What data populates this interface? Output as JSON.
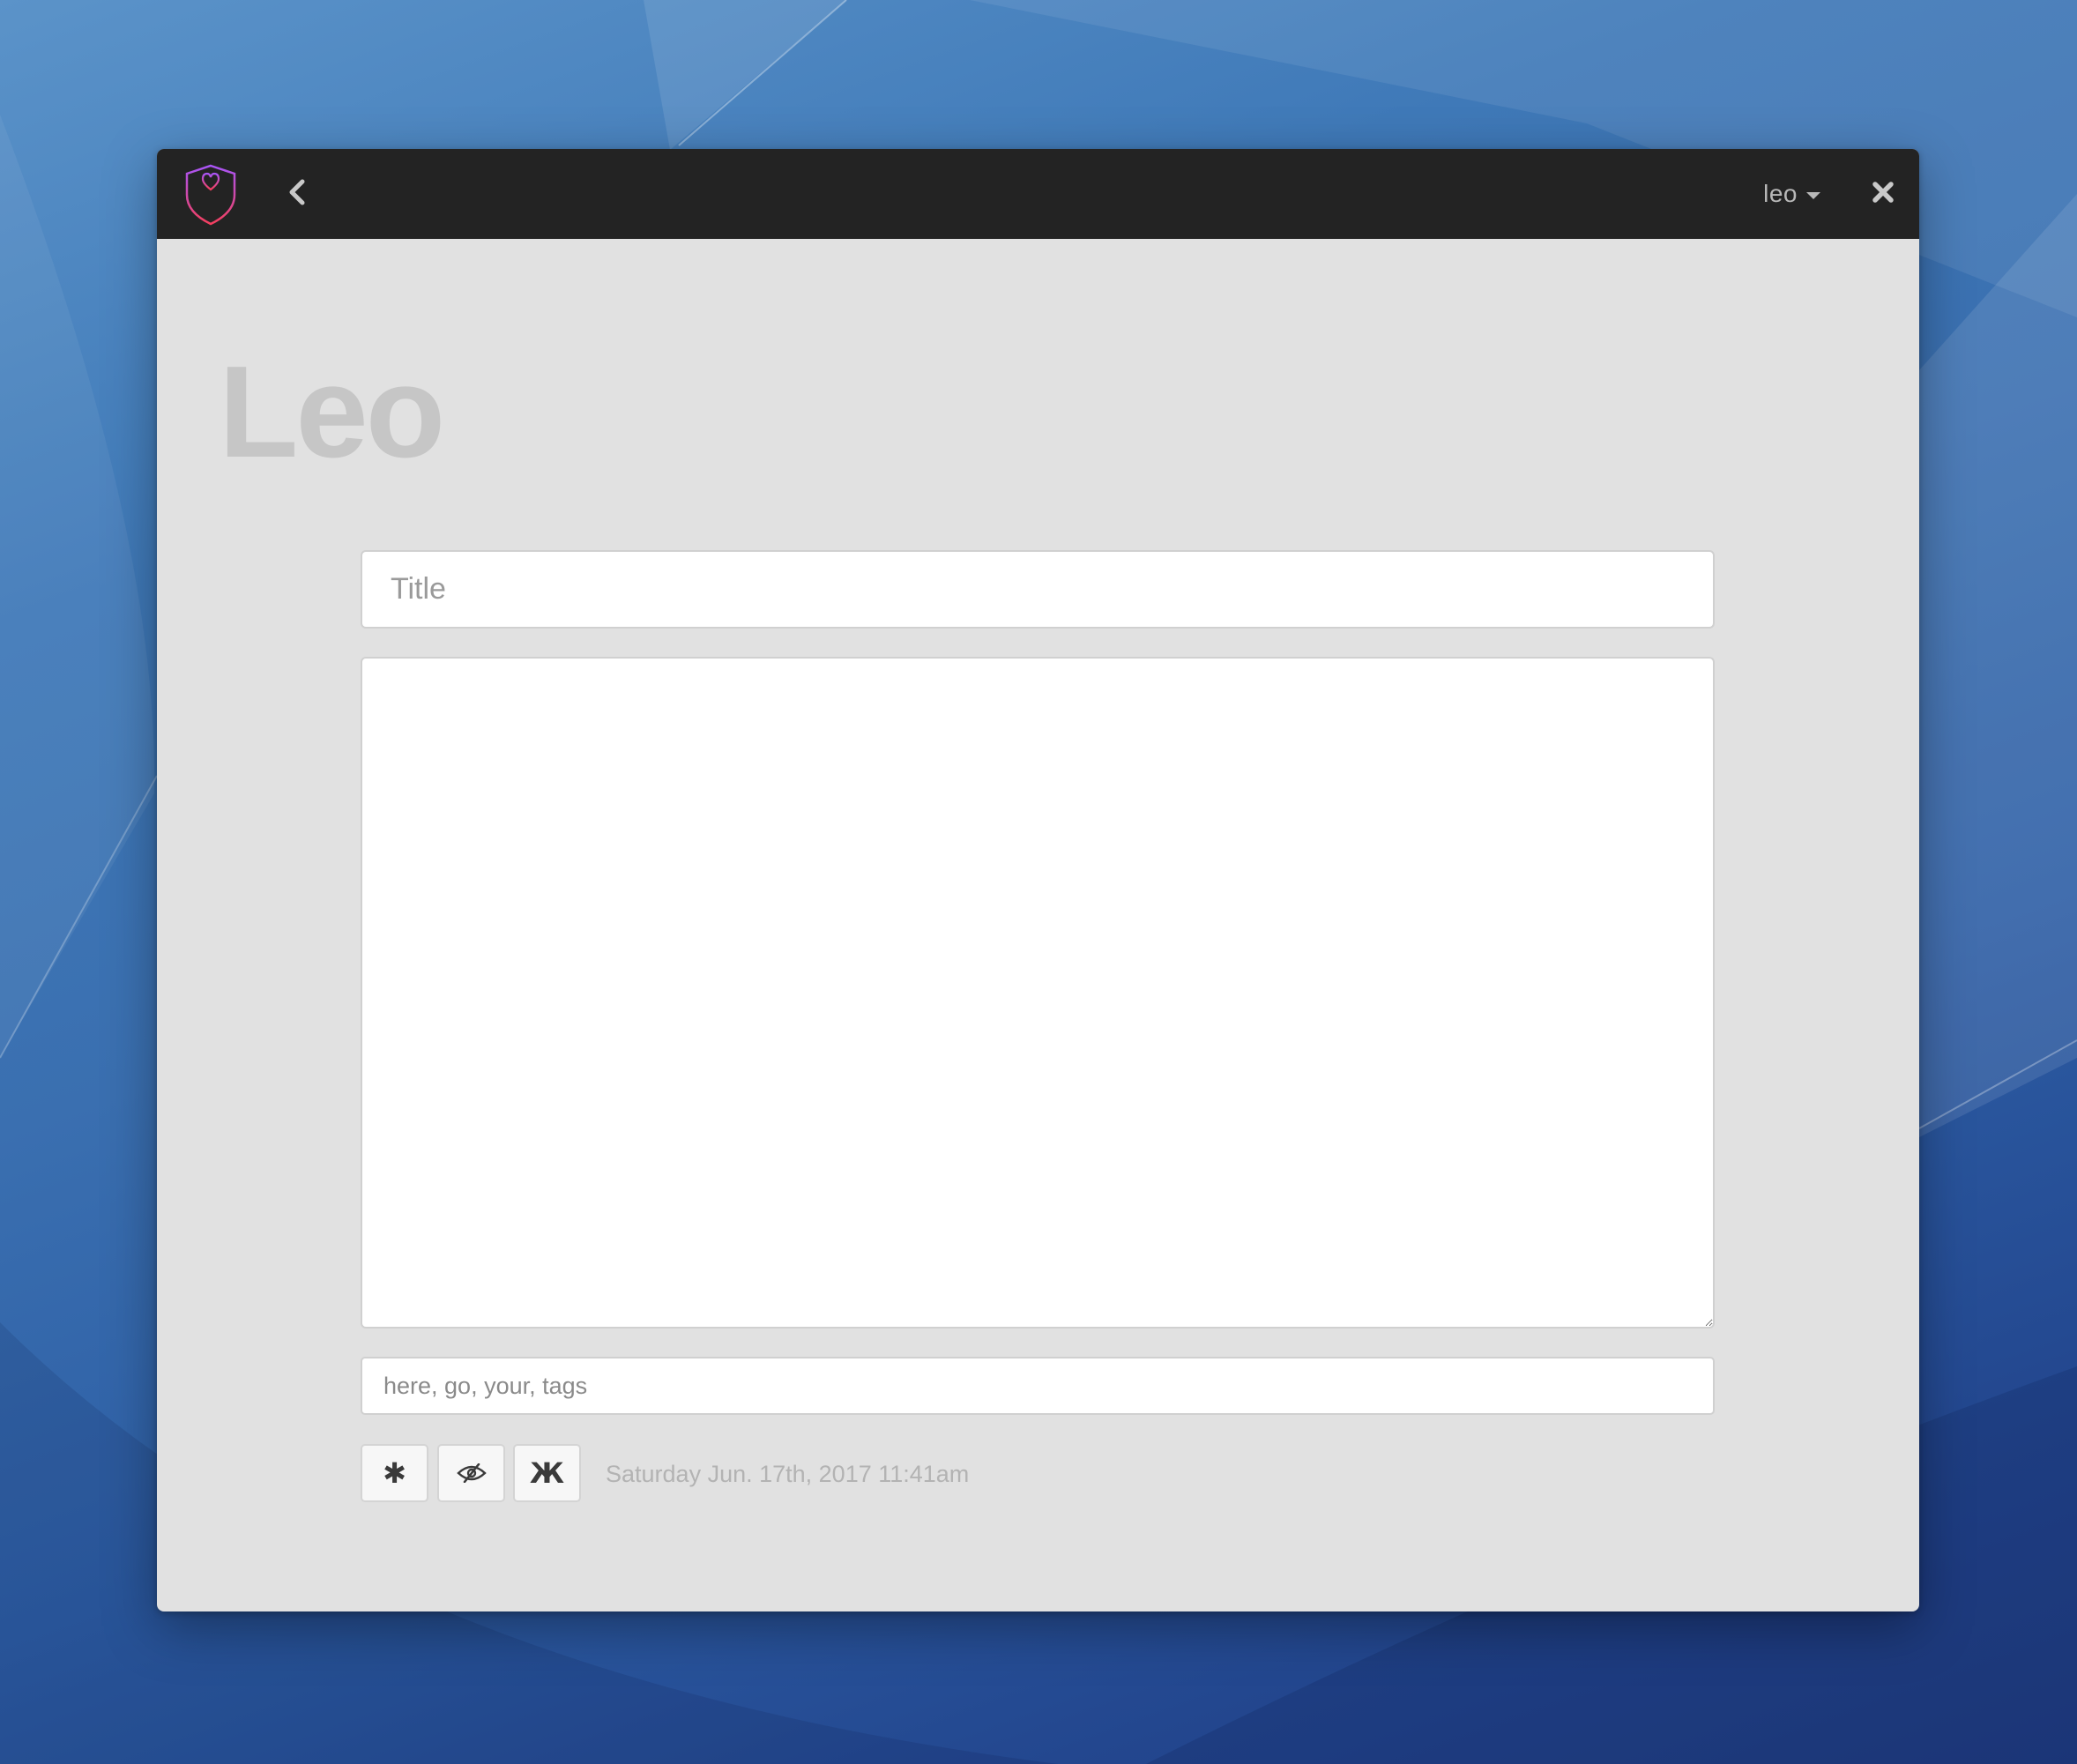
{
  "window": {
    "username": "leo"
  },
  "icons": {
    "logo": "shield-heart-female-logo-icon",
    "back": "chevron-left-icon",
    "user_caret": "caret-down-icon",
    "close": "close-x-icon",
    "asterisk": "asterisk-icon",
    "eye_slash": "eye-slash-icon",
    "zhe": "cyrillic-zhe-icon"
  },
  "page": {
    "heading": "Leo"
  },
  "editor": {
    "title_placeholder": "Title",
    "title_value": "",
    "body_value": "",
    "tags_placeholder": "here, go, your, tags",
    "tags_value": ""
  },
  "toolbar": {
    "asterisk_glyph": "✱",
    "zhe_glyph": "Ж",
    "timestamp": "Saturday Jun. 17th, 2017 11:41am"
  },
  "colors": {
    "titlebar": "#232323",
    "window_bg": "#e1e1e1",
    "logo_gradient_start": "#a855f7",
    "logo_gradient_end": "#f43f5e",
    "heading": "#c6c6c6",
    "timestamp": "#b3b3b3"
  }
}
